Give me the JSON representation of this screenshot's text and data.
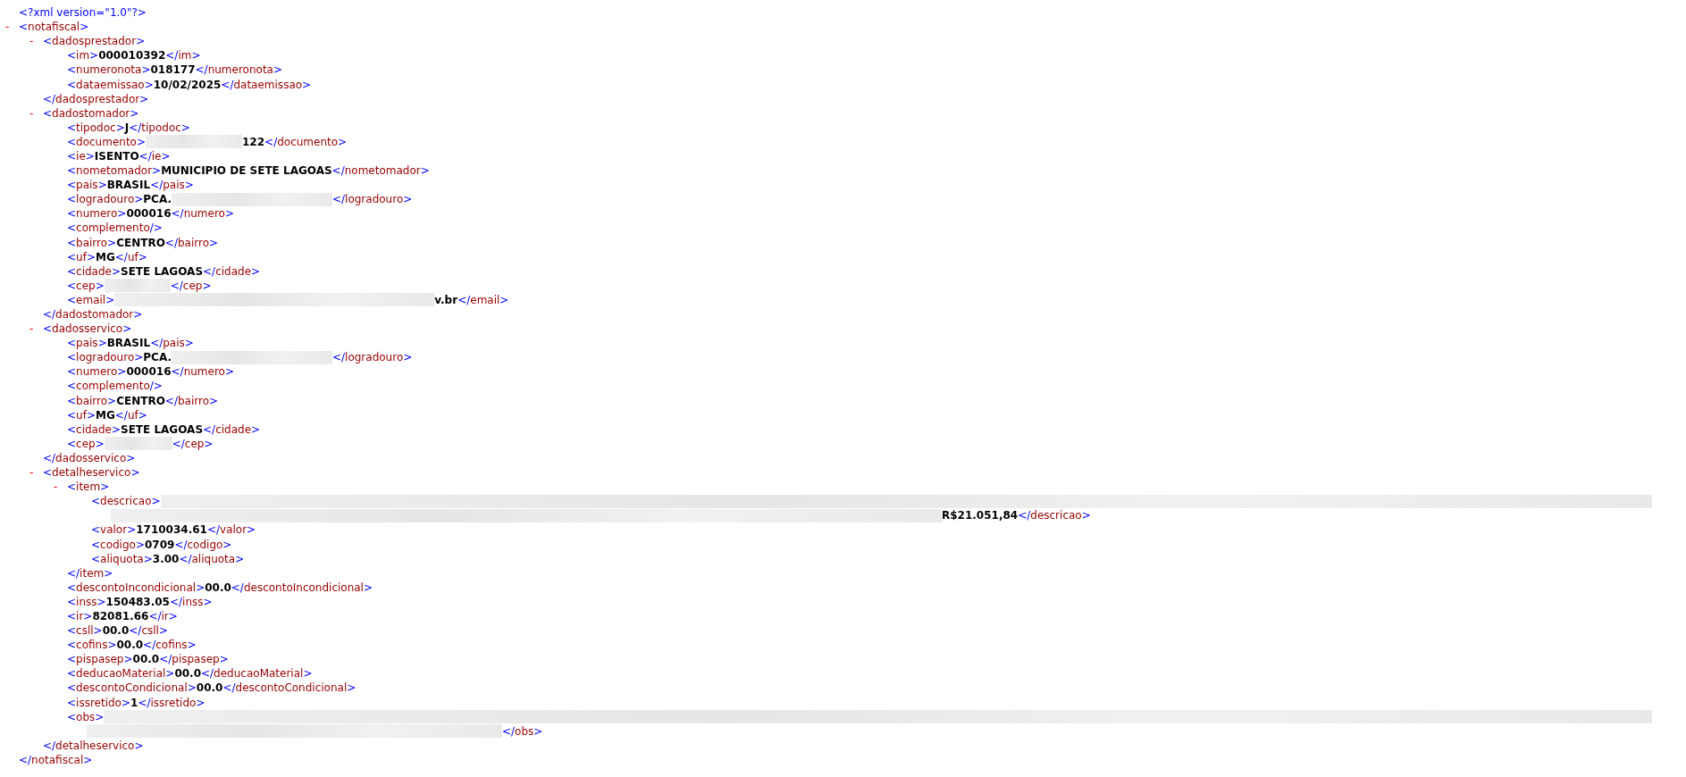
{
  "declaration": "<?xml version=\"1.0\"?>",
  "root": {
    "kind": "element",
    "toggle": "-",
    "expanded": true,
    "open": "<notafiscal>",
    "close": "</notafiscal>",
    "children": [
      {
        "kind": "element",
        "toggle": "-",
        "expanded": true,
        "open": "<dadosprestador>",
        "close": "</dadosprestador>",
        "children": [
          {
            "kind": "leaf",
            "open": "<im>",
            "close": "</im>",
            "parts": [
              {
                "kind": "text",
                "text": "000010392"
              }
            ]
          },
          {
            "kind": "leaf",
            "open": "<numeronota>",
            "close": "</numeronota>",
            "parts": [
              {
                "kind": "text",
                "text": "018177"
              }
            ]
          },
          {
            "kind": "leaf",
            "open": "<dataemissao>",
            "close": "</dataemissao>",
            "parts": [
              {
                "kind": "text",
                "text": "10/02/2025"
              }
            ]
          }
        ]
      },
      {
        "kind": "element",
        "toggle": "-",
        "expanded": true,
        "open": "<dadostomador>",
        "close": "</dadostomador>",
        "children": [
          {
            "kind": "leaf",
            "open": "<tipodoc>",
            "close": "</tipodoc>",
            "parts": [
              {
                "kind": "text",
                "text": "J"
              }
            ]
          },
          {
            "kind": "leaf",
            "open": "<documento>",
            "close": "</documento>",
            "parts": [
              {
                "kind": "blur"
              },
              {
                "kind": "text",
                "text": "122"
              }
            ]
          },
          {
            "kind": "leaf",
            "open": "<ie>",
            "close": "</ie>",
            "parts": [
              {
                "kind": "text",
                "text": "ISENTO"
              }
            ]
          },
          {
            "kind": "leaf",
            "open": "<nometomador>",
            "close": "</nometomador>",
            "parts": [
              {
                "kind": "text",
                "text": "MUNICIPIO DE SETE LAGOAS"
              }
            ]
          },
          {
            "kind": "leaf",
            "open": "<pais>",
            "close": "</pais>",
            "parts": [
              {
                "kind": "text",
                "text": "BRASIL"
              }
            ]
          },
          {
            "kind": "leaf",
            "open": "<logradouro>",
            "close": "</logradouro>",
            "parts": [
              {
                "kind": "text",
                "text": "PCA."
              },
              {
                "kind": "blur"
              }
            ]
          },
          {
            "kind": "leaf",
            "open": "<numero>",
            "close": "</numero>",
            "parts": [
              {
                "kind": "text",
                "text": "000016"
              }
            ]
          },
          {
            "kind": "leaf",
            "open": "<complemento/>"
          },
          {
            "kind": "leaf",
            "open": "<bairro>",
            "close": "</bairro>",
            "parts": [
              {
                "kind": "text",
                "text": "CENTRO"
              }
            ]
          },
          {
            "kind": "leaf",
            "open": "<uf>",
            "close": "</uf>",
            "parts": [
              {
                "kind": "text",
                "text": "MG"
              }
            ]
          },
          {
            "kind": "leaf",
            "open": "<cidade>",
            "close": "</cidade>",
            "parts": [
              {
                "kind": "text",
                "text": "SETE LAGOAS"
              }
            ]
          },
          {
            "kind": "leaf",
            "open": "<cep>",
            "close": "</cep>",
            "parts": [
              {
                "kind": "blur"
              }
            ]
          },
          {
            "kind": "leaf",
            "open": "<email>",
            "close": "</email>",
            "parts": [
              {
                "kind": "blur"
              },
              {
                "kind": "text",
                "text": "v.br"
              }
            ]
          }
        ]
      },
      {
        "kind": "element",
        "toggle": "-",
        "expanded": true,
        "open": "<dadosservico>",
        "close": "</dadosservico>",
        "children": [
          {
            "kind": "leaf",
            "open": "<pais>",
            "close": "</pais>",
            "parts": [
              {
                "kind": "text",
                "text": "BRASIL"
              }
            ]
          },
          {
            "kind": "leaf",
            "open": "<logradouro>",
            "close": "</logradouro>",
            "parts": [
              {
                "kind": "text",
                "text": "PCA."
              },
              {
                "kind": "blur"
              }
            ]
          },
          {
            "kind": "leaf",
            "open": "<numero>",
            "close": "</numero>",
            "parts": [
              {
                "kind": "text",
                "text": "000016"
              }
            ]
          },
          {
            "kind": "leaf",
            "open": "<complemento/>"
          },
          {
            "kind": "leaf",
            "open": "<bairro>",
            "close": "</bairro>",
            "parts": [
              {
                "kind": "text",
                "text": "CENTRO"
              }
            ]
          },
          {
            "kind": "leaf",
            "open": "<uf>",
            "close": "</uf>",
            "parts": [
              {
                "kind": "text",
                "text": "MG"
              }
            ]
          },
          {
            "kind": "leaf",
            "open": "<cidade>",
            "close": "</cidade>",
            "parts": [
              {
                "kind": "text",
                "text": "SETE LAGOAS"
              }
            ]
          },
          {
            "kind": "leaf",
            "open": "<cep>",
            "close": "</cep>",
            "parts": [
              {
                "kind": "blur"
              }
            ]
          }
        ]
      },
      {
        "kind": "element",
        "toggle": "-",
        "expanded": true,
        "open": "<detalheservico>",
        "close": "</detalheservico>",
        "children": [
          {
            "kind": "element",
            "toggle": "-",
            "expanded": true,
            "open": "<item>",
            "close": "</item>",
            "children": [
              {
                "kind": "leaf",
                "open": "<descricao>",
                "close": "</descricao>",
                "parts": [
                  {
                    "kind": "blur"
                  },
                  {
                    "kind": "break"
                  },
                  {
                    "kind": "blur"
                  },
                  {
                    "kind": "text",
                    "text": "R$21.051,84"
                  }
                ]
              },
              {
                "kind": "leaf",
                "open": "<valor>",
                "close": "</valor>",
                "parts": [
                  {
                    "kind": "text",
                    "text": "1710034.61"
                  }
                ]
              },
              {
                "kind": "leaf",
                "open": "<codigo>",
                "close": "</codigo>",
                "parts": [
                  {
                    "kind": "text",
                    "text": "0709"
                  }
                ]
              },
              {
                "kind": "leaf",
                "open": "<aliquota>",
                "close": "</aliquota>",
                "parts": [
                  {
                    "kind": "text",
                    "text": "3.00"
                  }
                ]
              }
            ]
          },
          {
            "kind": "leaf",
            "open": "<descontoIncondicional>",
            "close": "</descontoIncondicional>",
            "parts": [
              {
                "kind": "text",
                "text": "00.0"
              }
            ]
          },
          {
            "kind": "leaf",
            "open": "<inss>",
            "close": "</inss>",
            "parts": [
              {
                "kind": "text",
                "text": "150483.05"
              }
            ]
          },
          {
            "kind": "leaf",
            "open": "<ir>",
            "close": "</ir>",
            "parts": [
              {
                "kind": "text",
                "text": "82081.66"
              }
            ]
          },
          {
            "kind": "leaf",
            "open": "<csll>",
            "close": "</csll>",
            "parts": [
              {
                "kind": "text",
                "text": "00.0"
              }
            ]
          },
          {
            "kind": "leaf",
            "open": "<cofins>",
            "close": "</cofins>",
            "parts": [
              {
                "kind": "text",
                "text": "00.0"
              }
            ]
          },
          {
            "kind": "leaf",
            "open": "<pispasep>",
            "close": "</pispasep>",
            "parts": [
              {
                "kind": "text",
                "text": "00.0"
              }
            ]
          },
          {
            "kind": "leaf",
            "open": "<deducaoMaterial>",
            "close": "</deducaoMaterial>",
            "parts": [
              {
                "kind": "text",
                "text": "00.0"
              }
            ]
          },
          {
            "kind": "leaf",
            "open": "<descontoCondicional>",
            "close": "</descontoCondicional>",
            "parts": [
              {
                "kind": "text",
                "text": "00.0"
              }
            ]
          },
          {
            "kind": "leaf",
            "open": "<issretido>",
            "close": "</issretido>",
            "parts": [
              {
                "kind": "text",
                "text": "1"
              }
            ]
          },
          {
            "kind": "leaf",
            "open": "<obs>",
            "close": "</obs>",
            "parts": [
              {
                "kind": "blur"
              },
              {
                "kind": "break"
              },
              {
                "kind": "blur"
              }
            ]
          }
        ]
      }
    ]
  }
}
